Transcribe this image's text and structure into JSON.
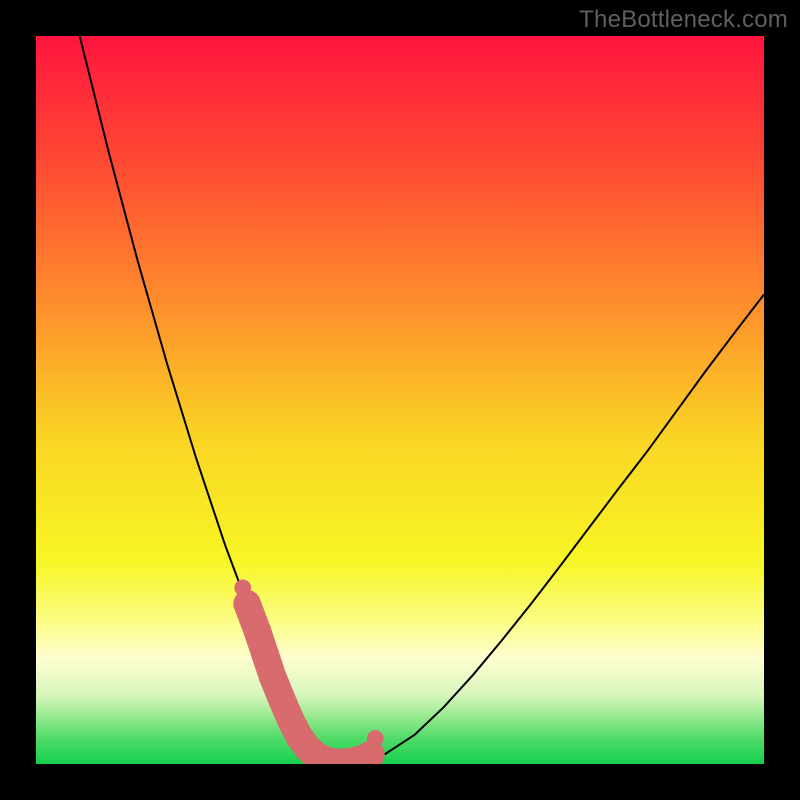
{
  "watermark": "TheBottleneck.com",
  "chart_data": {
    "type": "line",
    "title": "",
    "xlabel": "",
    "ylabel": "",
    "xlim": [
      0,
      100
    ],
    "ylim": [
      0,
      100
    ],
    "background_gradient": {
      "stops": [
        {
          "offset": 0.0,
          "color": "#ff153e"
        },
        {
          "offset": 0.18,
          "color": "#ff4b32"
        },
        {
          "offset": 0.38,
          "color": "#fd922c"
        },
        {
          "offset": 0.55,
          "color": "#fad424"
        },
        {
          "offset": 0.72,
          "color": "#f7f624"
        },
        {
          "offset": 0.8,
          "color": "#fbfd80"
        },
        {
          "offset": 0.855,
          "color": "#fefed0"
        },
        {
          "offset": 0.905,
          "color": "#d7f6bc"
        },
        {
          "offset": 0.935,
          "color": "#97ea8f"
        },
        {
          "offset": 0.965,
          "color": "#4fdb67"
        },
        {
          "offset": 1.0,
          "color": "#17cf4d"
        }
      ]
    },
    "series": [
      {
        "name": "bottleneck-curve",
        "stroke": "#000000",
        "stroke_width": 2,
        "x": [
          6,
          8,
          10,
          12,
          14,
          16,
          18,
          20,
          22,
          24,
          26,
          27.5,
          29,
          30,
          31,
          32,
          33,
          34.5,
          36,
          38,
          40,
          42.5,
          45,
          48,
          52,
          56,
          60,
          64,
          68,
          72,
          76,
          80,
          84,
          88,
          92,
          96,
          100
        ],
        "y": [
          100,
          92,
          84,
          76.5,
          69,
          62,
          55,
          48.5,
          42,
          36,
          30,
          26,
          22,
          19.2,
          16.5,
          14,
          11.5,
          8.3,
          5.2,
          2.5,
          0.9,
          0.2,
          0.4,
          1.4,
          4.0,
          7.8,
          12.2,
          17.0,
          22.0,
          27.2,
          32.5,
          37.8,
          43.0,
          48.5,
          54.0,
          59.3,
          64.5
        ]
      }
    ],
    "highlight": {
      "color": "#d86b6e",
      "dot_radius": 1.15,
      "thick_dot_radius": 1.9,
      "points_x": [
        29.0,
        30.4,
        31.5,
        32.5,
        33.8,
        35.0,
        36.2,
        37.4,
        38.6,
        39.8,
        41.0,
        42.2,
        43.4,
        45.0,
        46.0
      ],
      "points_y": [
        22.0,
        18.3,
        15.0,
        12.0,
        8.8,
        6.0,
        3.7,
        2.1,
        1.1,
        0.5,
        0.2,
        0.2,
        0.35,
        0.7,
        1.3
      ],
      "end_sentinel_dots": true
    }
  }
}
